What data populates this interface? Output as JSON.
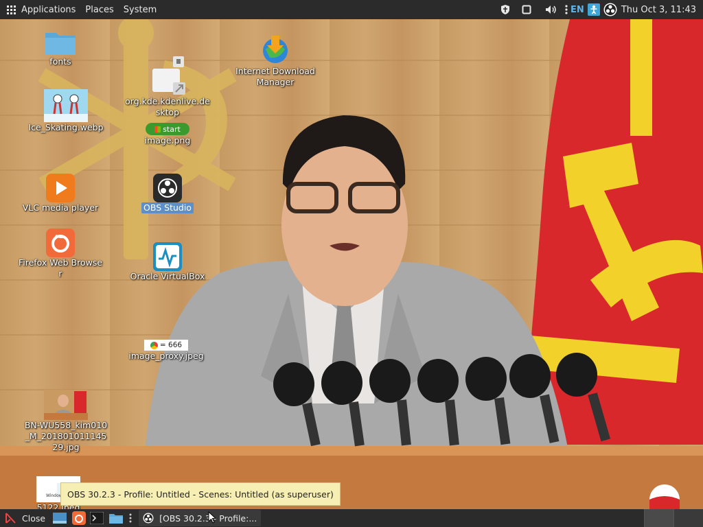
{
  "top_panel": {
    "menus": [
      "Applications",
      "Places",
      "System"
    ],
    "keyboard_layout": "EN",
    "clock": "Thu Oct  3, 11:43"
  },
  "desktop": {
    "icons": [
      {
        "label": "fonts",
        "icon": "folder-icon"
      },
      {
        "label": "Ice_Skating.webp",
        "icon": "image-file-icon"
      },
      {
        "label": "VLC media player",
        "icon": "vlc-icon"
      },
      {
        "label": "Firefox Web Browser",
        "icon": "firefox-icon"
      },
      {
        "label": "org.kde.kdenlive.desktop",
        "icon": "desktop-file-icon"
      },
      {
        "label": "image.png",
        "icon": "image-file-icon",
        "thumb_text": "start"
      },
      {
        "label": "OBS Studio",
        "icon": "obs-icon",
        "selected": true
      },
      {
        "label": "Oracle VirtualBox",
        "icon": "virtualbox-icon"
      },
      {
        "label": "image_proxy.jpeg",
        "icon": "image-file-icon",
        "thumb_text": "= 666"
      },
      {
        "label": "BN-WU558_kim010_M_20180101114529.jpg",
        "icon": "image-file-icon"
      },
      {
        "label": "Internet Download Manager",
        "icon": "idm-icon"
      },
      {
        "label": "5122.jpeg",
        "icon": "image-file-icon"
      }
    ]
  },
  "tooltip": "OBS 30.2.3 - Profile: Untitled - Scenes: Untitled (as superuser)",
  "bottom_panel": {
    "close_label": "Close",
    "task_button": "[OBS 30.2.3 - Profile:..."
  },
  "colors": {
    "panel_bg": "#2b2b2b",
    "panel_text": "#e8e8e8",
    "tooltip_bg": "#f7eeb4",
    "selection": "#5d8fc9",
    "flag_red": "#d8282c",
    "flag_gold": "#f2d12a"
  }
}
